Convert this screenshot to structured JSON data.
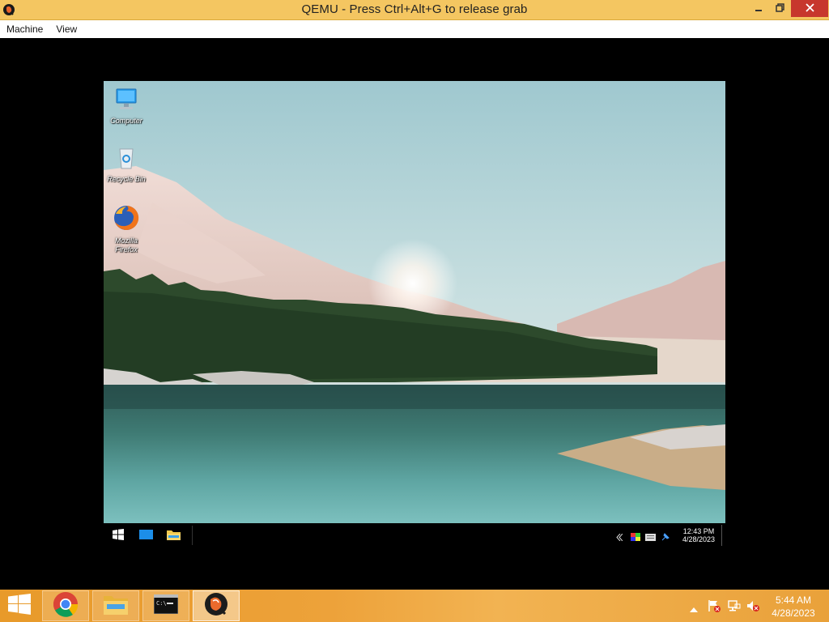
{
  "window": {
    "title": "QEMU - Press Ctrl+Alt+G to release grab",
    "app_icon": "qemu-icon",
    "controls": [
      "minimize-icon",
      "restore-icon",
      "close-icon"
    ],
    "close_color": "#c7372d",
    "titlebar_color": "#f4c661"
  },
  "menubar": {
    "items": [
      {
        "label": "Machine"
      },
      {
        "label": "View"
      }
    ]
  },
  "guest": {
    "desktop_icons": [
      {
        "label": "Computer",
        "icon": "computer-icon"
      },
      {
        "label": "Recycle Bin",
        "icon": "recycle-bin-icon"
      },
      {
        "label": "Mozilla Firefox",
        "icon": "firefox-icon"
      }
    ],
    "taskbar": {
      "buttons": [
        "windows-start-icon",
        "explorer-window-icon",
        "folder-icon"
      ],
      "tray_icons": [
        "chevron-left-icon",
        "color-palette-icon",
        "keyboard-icon",
        "pin-icon"
      ],
      "time": "12:43 PM",
      "date": "4/28/2023"
    }
  },
  "host_taskbar": {
    "apps": [
      {
        "name": "Google Chrome",
        "icon": "chrome-icon"
      },
      {
        "name": "File Explorer",
        "icon": "file-explorer-icon"
      },
      {
        "name": "Command Prompt",
        "icon": "command-prompt-icon"
      },
      {
        "name": "QEMU",
        "icon": "qemu-icon",
        "active": true
      }
    ],
    "tray_icons": [
      "show-hidden-icons-icon",
      "action-center-flag-icon",
      "network-icon",
      "volume-muted-icon"
    ],
    "time": "5:44 AM",
    "date": "4/28/2023",
    "accent": "#eda23a"
  }
}
